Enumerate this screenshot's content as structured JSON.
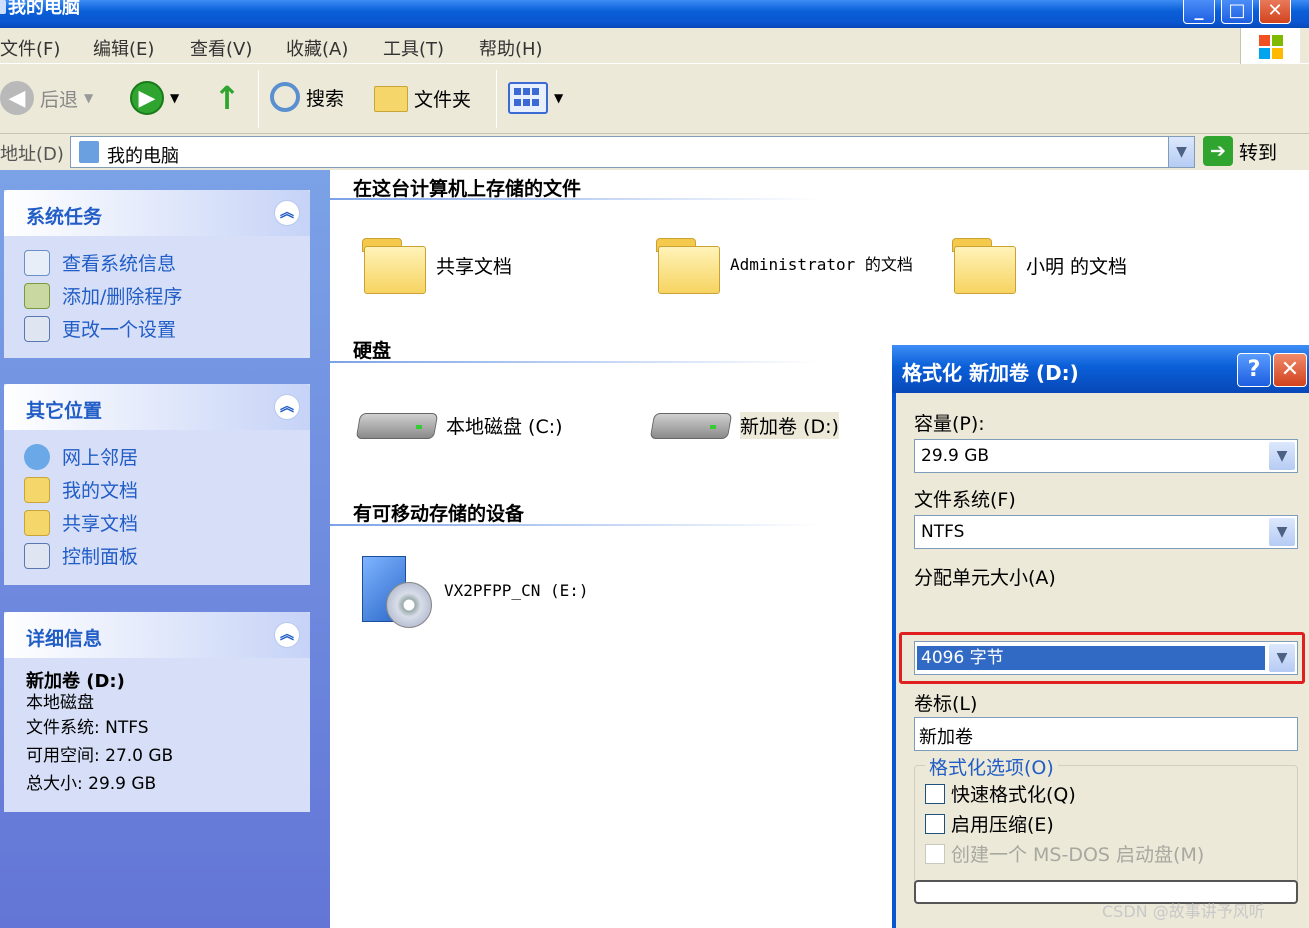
{
  "window": {
    "title": "我的电脑"
  },
  "menu": [
    "文件(F)",
    "编辑(E)",
    "查看(V)",
    "收藏(A)",
    "工具(T)",
    "帮助(H)"
  ],
  "toolbar": {
    "back": "后退",
    "search": "搜索",
    "folders": "文件夹"
  },
  "address": {
    "label": "地址(D)",
    "value": "我的电脑",
    "go": "转到"
  },
  "left": {
    "system_tasks": {
      "title": "系统任务",
      "links": [
        "查看系统信息",
        "添加/删除程序",
        "更改一个设置"
      ]
    },
    "other_places": {
      "title": "其它位置",
      "links": [
        "网上邻居",
        "我的文档",
        "共享文档",
        "控制面板"
      ]
    },
    "details": {
      "title": "详细信息",
      "name": "新加卷 (D:)",
      "type": "本地磁盘",
      "fs": "文件系统: NTFS",
      "free": "可用空间: 27.0 GB",
      "total": "总大小: 29.9 GB"
    }
  },
  "content": {
    "stored_files": {
      "title": "在这台计算机上存储的文件",
      "items": [
        "共享文档",
        "Administrator 的文档",
        "小明 的文档"
      ]
    },
    "hard_disks": {
      "title": "硬盘",
      "items": [
        "本地磁盘 (C:)",
        "新加卷 (D:)"
      ]
    },
    "removable": {
      "title": "有可移动存储的设备",
      "items": [
        "VX2PFPP_CN (E:)"
      ]
    }
  },
  "dialog": {
    "title": "格式化 新加卷 (D:)",
    "help": "?",
    "capacity_label": "容量(P):",
    "capacity_value": "29.9 GB",
    "fs_label": "文件系统(F)",
    "fs_value": "NTFS",
    "alloc_label": "分配单元大小(A)",
    "alloc_value": "4096 字节",
    "volume_label": "卷标(L)",
    "volume_value": "新加卷",
    "options_title": "格式化选项(O)",
    "quick_format": "快速格式化(Q)",
    "compression": "启用压缩(E)",
    "msdos_disk": "创建一个 MS-DOS 启动盘(M)"
  },
  "watermark": "CSDN @故事讲予风听",
  "colors": {
    "xp_blue": "#0a55d0",
    "link": "#215dc6",
    "highlight": "#e02020"
  }
}
